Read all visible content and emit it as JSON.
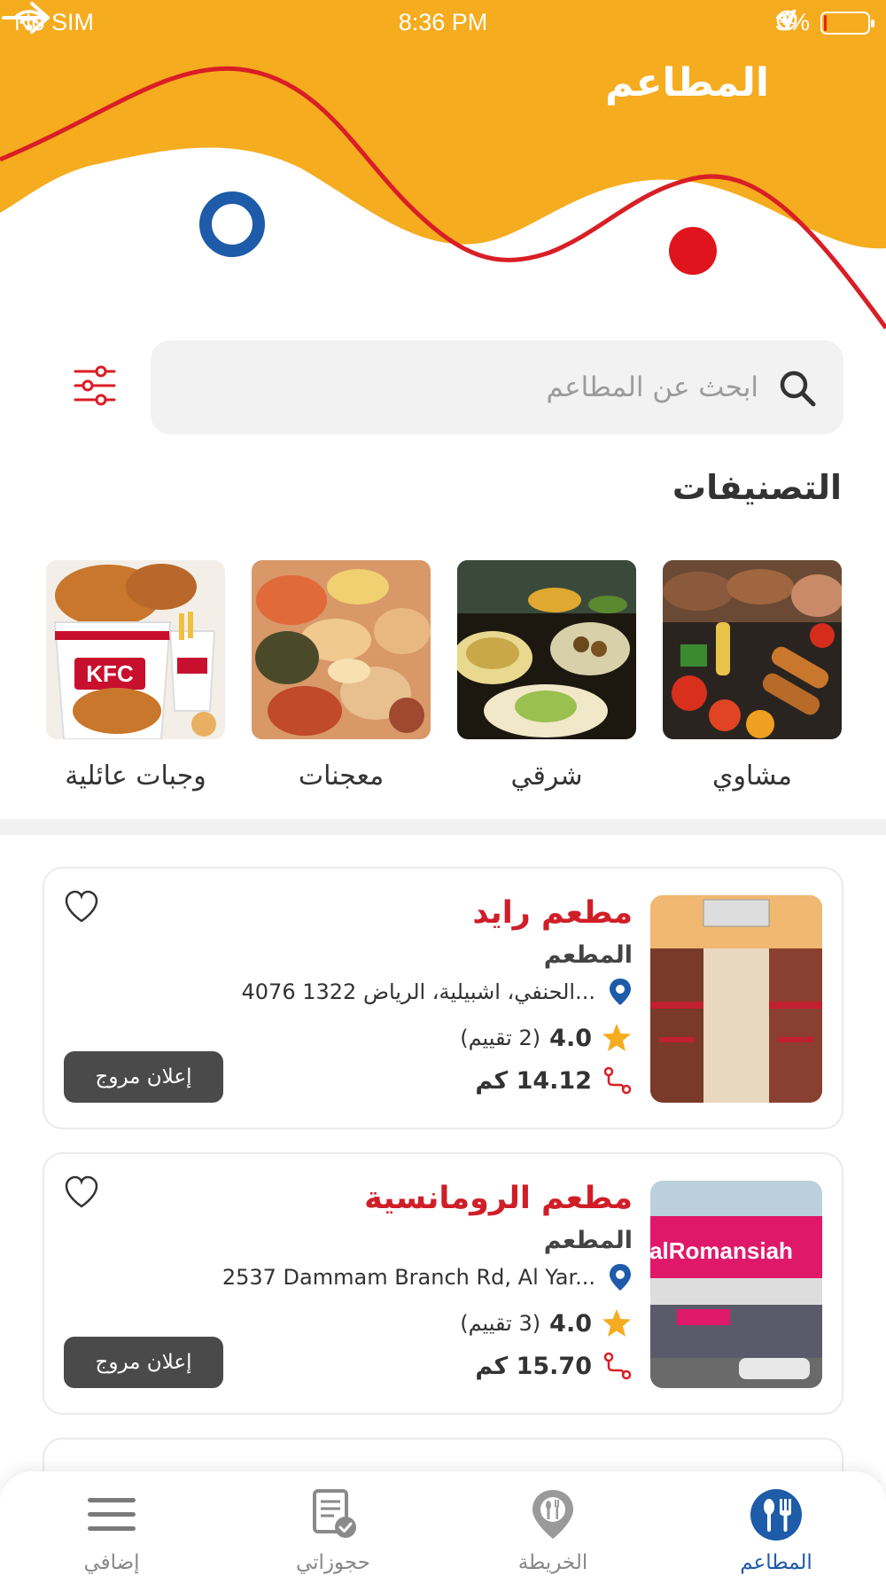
{
  "status_bar": {
    "carrier": "No SIM",
    "time": "8:36 PM",
    "battery": "3%"
  },
  "header": {
    "title": "المطاعم"
  },
  "search": {
    "placeholder": "ابحث عن المطاعم"
  },
  "categories": {
    "title": "التصنيفات",
    "items": [
      {
        "label": "مشاوي"
      },
      {
        "label": "شرقي"
      },
      {
        "label": "معجنات"
      },
      {
        "label": "وجبات عائلية"
      }
    ]
  },
  "restaurants": [
    {
      "name": "مطعم رايد",
      "type": "المطعم",
      "address": "4076 الحنفي، اشبيلية، الرياض 1322...",
      "rating": "4.0",
      "rating_count": "(2 تقييم)",
      "distance": "14.12 كم",
      "promo_label": "إعلان مروج"
    },
    {
      "name": "مطعم الرومانسية",
      "type": "المطعم",
      "address": "2537 Dammam Branch Rd, Al Yar...",
      "rating": "4.0",
      "rating_count": "(3 تقييم)",
      "distance": "15.70 كم",
      "promo_label": "إعلان مروج"
    }
  ],
  "tabbar": {
    "items": [
      {
        "label": "المطاعم",
        "icon": "restaurant-icon",
        "active": true
      },
      {
        "label": "الخريطة",
        "icon": "map-pin-icon",
        "active": false
      },
      {
        "label": "حجوزاتي",
        "icon": "bookings-icon",
        "active": false
      },
      {
        "label": "إضافي",
        "icon": "menu-icon",
        "active": false
      }
    ]
  },
  "colors": {
    "header_yellow": "#f5ac1f",
    "accent_red": "#d91e26",
    "accent_blue": "#1e5ba8",
    "promo_gray": "#4a4a4a"
  }
}
